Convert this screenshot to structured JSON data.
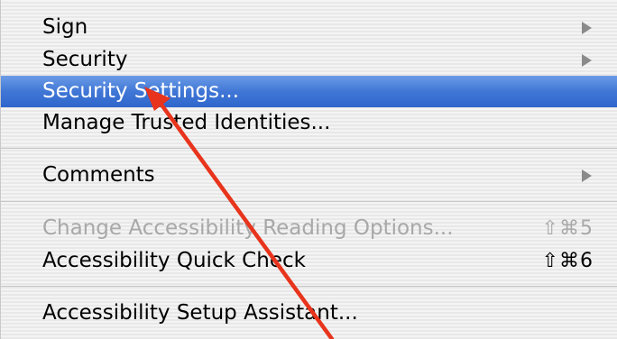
{
  "menu": {
    "items": [
      {
        "label": "Sign",
        "submenu": true,
        "enabled": true
      },
      {
        "label": "Security",
        "submenu": true,
        "enabled": true
      },
      {
        "label": "Security Settings...",
        "highlighted": true,
        "enabled": true
      },
      {
        "label": "Manage Trusted Identities...",
        "enabled": true
      },
      {
        "label": "Comments",
        "submenu": true,
        "enabled": true
      },
      {
        "label": "Change Accessibility Reading Options...",
        "shortcut": "⇧⌘5",
        "enabled": false
      },
      {
        "label": "Accessibility Quick Check",
        "shortcut": "⇧⌘6",
        "enabled": true
      },
      {
        "label": "Accessibility Setup Assistant...",
        "enabled": true
      }
    ]
  },
  "colors": {
    "highlight": "#3f7ad8",
    "annotation_arrow": "#e8341c",
    "disabled_text": "#a8a8a8",
    "submenu_arrow": "#8a8a8a"
  },
  "icons": {
    "submenu": "submenu-arrow-icon",
    "annotation": "annotation-arrow-icon"
  }
}
